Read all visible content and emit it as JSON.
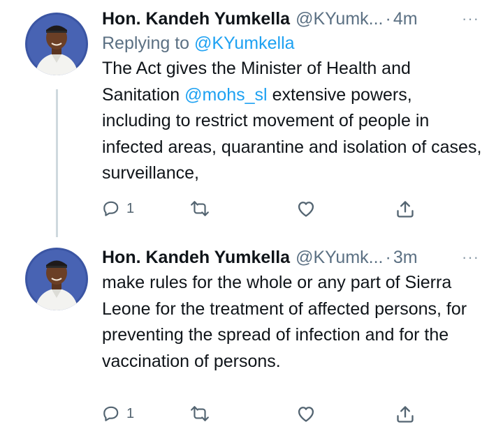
{
  "tweets": [
    {
      "author_name": "Hon. Kandeh Yumkella",
      "handle": "@KYumk...",
      "separator": "·",
      "time": "4m",
      "more": "···",
      "replying_prefix": "Replying to ",
      "replying_handle": "@KYumkella",
      "text_before": "The Act gives the Minister of Health and Sanitation ",
      "text_mention": "@mohs_sl",
      "text_after": " extensive powers, including to restrict movement of people in infected areas, quarantine and isolation of cases, surveillance,",
      "reply_count": "1",
      "retweet_icon": "retweet-icon",
      "like_icon": "heart-icon",
      "share_icon": "share-icon"
    },
    {
      "author_name": "Hon. Kandeh Yumkella",
      "handle": "@KYumk...",
      "separator": "·",
      "time": "3m",
      "more": "···",
      "text": "make rules for the whole or any part of Sierra Leone for the treatment of affected persons, for preventing the spread of infection and for the vaccination of persons.",
      "reply_count": "1",
      "retweet_icon": "retweet-icon",
      "like_icon": "heart-icon",
      "share_icon": "share-icon"
    }
  ],
  "colors": {
    "link": "#1da1f2",
    "secondary_text": "#5b7083",
    "thread_line": "#cfd9de",
    "avatar_bg": "#3b55a3"
  }
}
